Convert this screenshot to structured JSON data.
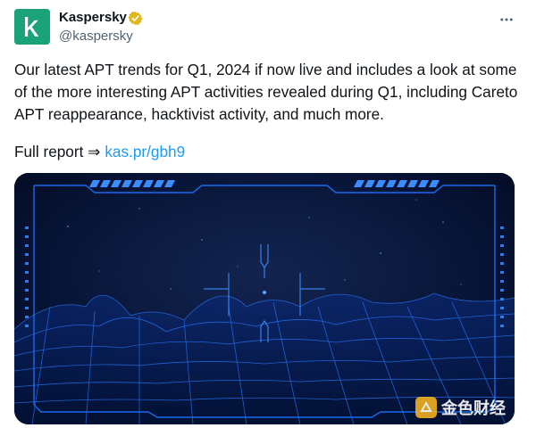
{
  "author": {
    "name": "Kaspersky",
    "handle": "@kaspersky",
    "avatar_icon": "kaspersky-k-logo",
    "verified_icon": "verified-badge-gold",
    "brand_color": "#1aa278"
  },
  "tweet": {
    "text": "Our latest APT trends for Q1, 2024 if now live and includes a look at some of the more interesting APT activities revealed during Q1, including Careto APT reappearance, hacktivist activity, and much more.",
    "report_prefix": "Full report ⇒ ",
    "report_link": "kas.pr/gbh9",
    "link_color": "#1d9bf0"
  },
  "menu": {
    "icon": "more-dots-icon"
  },
  "media": {
    "description_icon": "cyber-grid-image",
    "accent": "#1e73ff"
  },
  "watermark": {
    "text": "金色财经",
    "icon": "jinse-logo"
  }
}
